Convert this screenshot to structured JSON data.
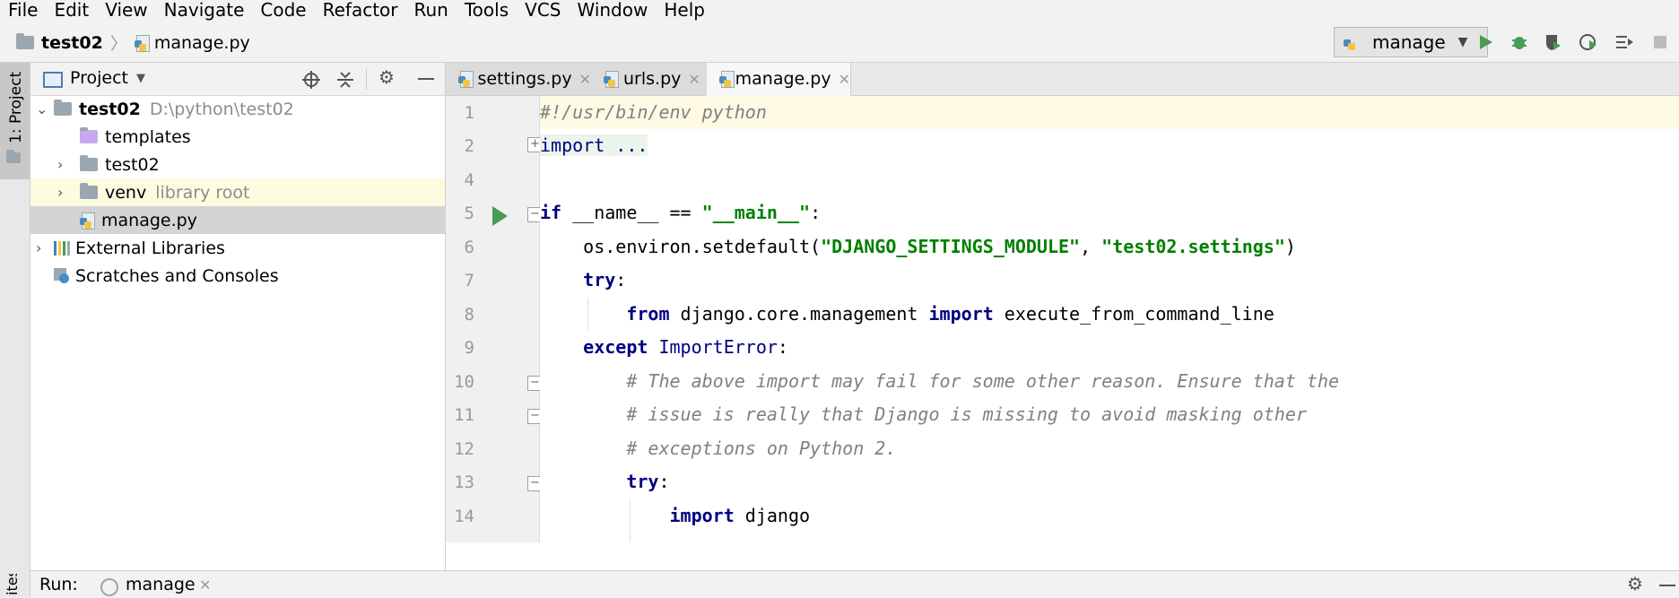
{
  "menubar": [
    "File",
    "Edit",
    "View",
    "Navigate",
    "Code",
    "Refactor",
    "Run",
    "Tools",
    "VCS",
    "Window",
    "Help"
  ],
  "breadcrumb": {
    "project": "test02",
    "file": "manage.py"
  },
  "run_config": {
    "name": "manage"
  },
  "left_strip": {
    "project_tab": "1: Project",
    "favorites": "ites"
  },
  "project_panel": {
    "title": "Project",
    "tree": [
      {
        "label": "test02",
        "hint": "D:\\python\\test02"
      },
      {
        "label": "templates",
        "hint": ""
      },
      {
        "label": "test02",
        "hint": ""
      },
      {
        "label": "venv",
        "hint": "library root"
      },
      {
        "label": "manage.py",
        "hint": ""
      },
      {
        "label": "External Libraries",
        "hint": ""
      },
      {
        "label": "Scratches and Consoles",
        "hint": ""
      }
    ]
  },
  "tabs": [
    {
      "label": "settings.py"
    },
    {
      "label": "urls.py"
    },
    {
      "label": "manage.py"
    }
  ],
  "code_lines": [
    {
      "n": "1",
      "text": "#!/usr/bin/env python"
    },
    {
      "n": "2",
      "text": "import ..."
    },
    {
      "n": "4",
      "text": ""
    },
    {
      "n": "5",
      "text": "if __name__ == \"__main__\":"
    },
    {
      "n": "6",
      "text": "os.environ.setdefault(\"DJANGO_SETTINGS_MODULE\", \"test02.settings\")"
    },
    {
      "n": "7",
      "text": "try:"
    },
    {
      "n": "8",
      "text": "from django.core.management import execute_from_command_line"
    },
    {
      "n": "9",
      "text": "except ImportError:"
    },
    {
      "n": "10",
      "text": "# The above import may fail for some other reason. Ensure that the"
    },
    {
      "n": "11",
      "text": "# issue is really that Django is missing to avoid masking other"
    },
    {
      "n": "12",
      "text": "# exceptions on Python 2."
    },
    {
      "n": "13",
      "text": "try:"
    },
    {
      "n": "14",
      "text": "import django"
    }
  ],
  "bottom": {
    "run_label": "Run:",
    "run_tab": "manage"
  },
  "colors": {
    "keyword": "#000080",
    "string": "#008000",
    "comment": "#808080",
    "run_green": "#499c54",
    "current_line": "#fffae3"
  }
}
